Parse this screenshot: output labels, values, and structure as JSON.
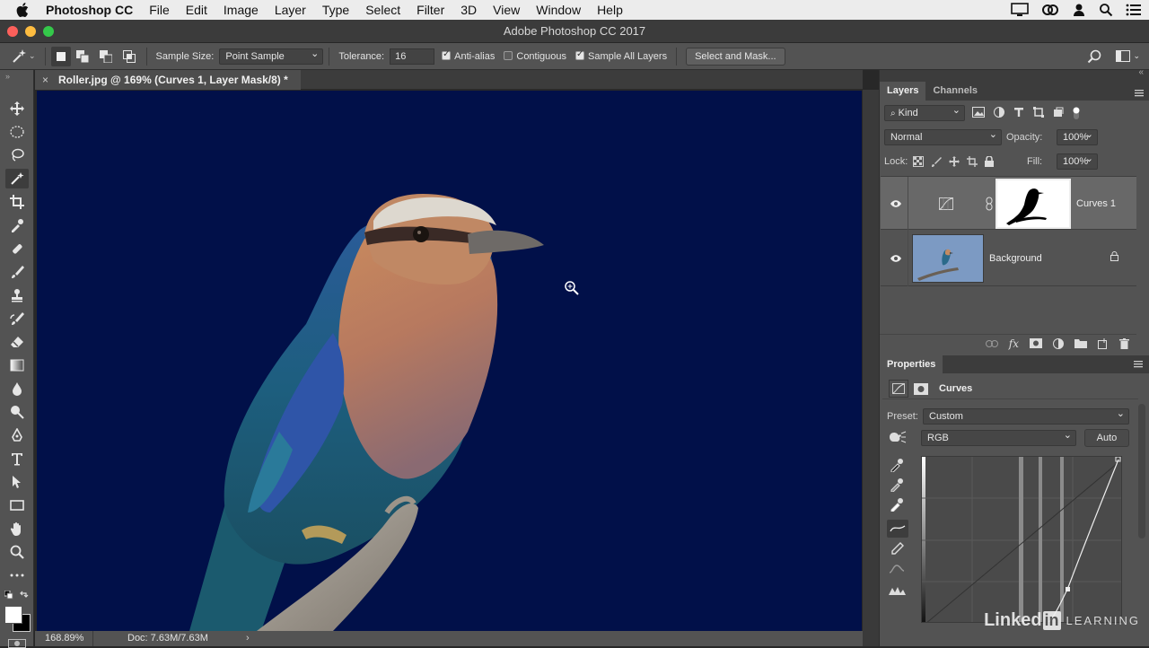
{
  "menubar": {
    "app": "Photoshop CC",
    "items": [
      "File",
      "Edit",
      "Image",
      "Layer",
      "Type",
      "Select",
      "Filter",
      "3D",
      "View",
      "Window",
      "Help"
    ]
  },
  "window": {
    "title": "Adobe Photoshop CC 2017"
  },
  "options": {
    "sample_size_label": "Sample Size:",
    "sample_size_value": "Point Sample",
    "tolerance_label": "Tolerance:",
    "tolerance_value": "16",
    "anti_alias": "Anti-alias",
    "contiguous": "Contiguous",
    "sample_all_layers": "Sample All Layers",
    "select_mask_button": "Select and Mask..."
  },
  "document": {
    "tab_title": "Roller.jpg @ 169% (Curves 1, Layer Mask/8) *",
    "zoom": "168.89%",
    "doc_info": "Doc: 7.63M/7.63M",
    "canvas_color": "#011049"
  },
  "layers_panel": {
    "tabs": [
      "Layers",
      "Channels"
    ],
    "filter_kind": "Kind",
    "blend_mode": "Normal",
    "opacity_label": "Opacity:",
    "opacity_value": "100%",
    "lock_label": "Lock:",
    "fill_label": "Fill:",
    "fill_value": "100%",
    "layers": [
      {
        "name": "Curves 1"
      },
      {
        "name": "Background"
      }
    ]
  },
  "properties_panel": {
    "title": "Properties",
    "adjustment_name": "Curves",
    "preset_label": "Preset:",
    "preset_value": "Custom",
    "channel_value": "RGB",
    "auto_button": "Auto"
  },
  "watermark": {
    "brand": "Linked",
    "brand_in": "in",
    "suffix": "LEARNING"
  },
  "colors": {
    "accent_blue": "#011049",
    "panel": "#535353",
    "dark": "#3c3c3c"
  }
}
